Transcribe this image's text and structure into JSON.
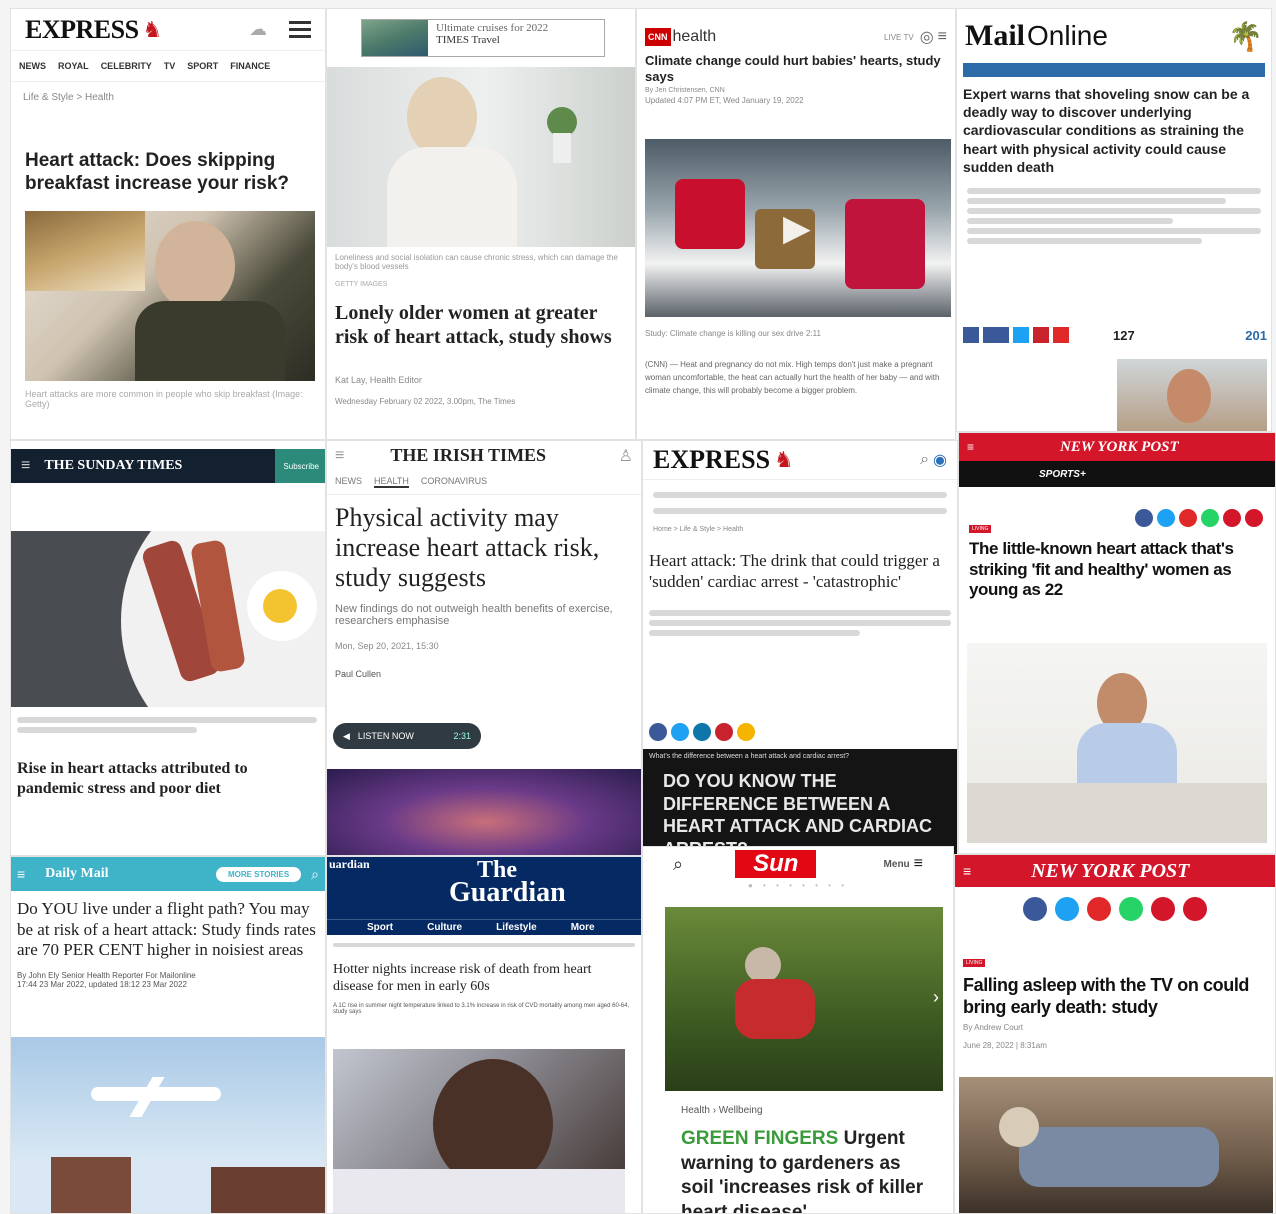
{
  "express1": {
    "logo": "EXPRESS",
    "nav": [
      "NEWS",
      "ROYAL",
      "CELEBRITY",
      "TV",
      "SPORT",
      "FINANCE"
    ],
    "breadcrumb": "Life & Style > Health",
    "headline": "Heart attack: Does skipping breakfast increase your risk?",
    "caption": "Heart attacks are more common in people who skip breakfast (Image: Getty)"
  },
  "times": {
    "ad": "Ultimate cruises for 2022",
    "ad_brand": "TIMES Travel",
    "caption": "Loneliness and social isolation can cause chronic stress, which can damage the body's blood vessels",
    "credit": "GETTY IMAGES",
    "headline": "Lonely older women at greater risk of heart attack, study shows",
    "byline": "Kat Lay, Health Editor",
    "date": "Wednesday February 02 2022, 3.00pm, The Times"
  },
  "cnn": {
    "logo": "health",
    "live": "LIVE TV",
    "headline": "Climate change could hurt babies' hearts, study says",
    "byline": "By Jen Christensen, CNN",
    "updated": "Updated 4:07 PM ET, Wed January 19, 2022",
    "video_caption": "Study: Climate change is killing our sex drive 2:11",
    "body": "(CNN) — Heat and pregnancy do not mix. High temps don't just make a pregnant woman uncomfortable, the heat can actually hurt the health of her baby — and with climate change, this will probably become a bigger problem."
  },
  "mail": {
    "logo_a": "Mail",
    "logo_b": "Online",
    "headline": "Expert warns that shoveling snow can be a deadly way to discover underlying cardiovascular conditions as straining the heart with physical activity could cause sudden death",
    "shares": "127",
    "comments": "201"
  },
  "sundaytimes": {
    "logo": "THE SUNDAY TIMES",
    "subscribe": "Subscribe",
    "headline": "Rise in heart attacks attributed to pandemic stress and poor diet"
  },
  "irish": {
    "logo": "THE IRISH TIMES",
    "nav": [
      "NEWS",
      "HEALTH",
      "CORONAVIRUS"
    ],
    "headline": "Physical activity may increase heart attack risk, study suggests",
    "standfirst": "New findings do not outweigh health benefits of exercise, researchers emphasise",
    "date": "Mon, Sep 20, 2021, 15:30",
    "byline": "Paul Cullen",
    "listen": "LISTEN NOW",
    "duration": "2:31"
  },
  "express2": {
    "logo": "EXPRESS",
    "breadcrumb": "Home > Life & Style > Health",
    "headline": "Heart attack: The drink that could trigger a 'sudden' cardiac arrest - 'catastrophic'",
    "video_title": "What's the difference between a heart attack and cardiac arrest?",
    "video_text": "DO YOU KNOW THE DIFFERENCE BETWEEN A HEART ATTACK AND CARDIAC ARREST?"
  },
  "nypost1": {
    "logo": "NEW YORK POST",
    "sports": "SPORTS+",
    "headline": "The little-known heart attack that's striking 'fit and healthy' women as young as 22",
    "tag": "LIVING"
  },
  "dailymail": {
    "logo": "Daily Mail",
    "more": "MORE STORIES",
    "headline": "Do YOU live under a flight path? You may be at risk of a heart attack: Study finds rates are 70 PER CENT higher in noisiest areas",
    "byline": "By John Ely Senior Health Reporter For Mailonline",
    "date": "17:44 23 Mar 2022, updated 18:12 23 Mar 2022"
  },
  "guardian": {
    "edge": "uardian",
    "logo_a": "The",
    "logo_b": "Guardian",
    "nav": [
      "Sport",
      "Culture",
      "Lifestyle",
      "More"
    ],
    "headline": "Hotter nights increase risk of death from heart disease for men in early 60s",
    "standfirst": "A 1C rise in summer night temperature linked to 3.1% increase in risk of CVD mortality among men aged 60-64, study says"
  },
  "sun": {
    "logo": "Sun",
    "menu": "Menu",
    "breadcrumb_a": "Health",
    "breadcrumb_b": "Wellbeing",
    "kicker": "GREEN FINGERS",
    "headline": "Urgent warning to gardeners as soil 'increases risk of killer heart disease'"
  },
  "nypost2": {
    "logo": "NEW YORK POST",
    "tag": "LIVING",
    "headline": "Falling asleep with the TV on could bring early death: study",
    "byline": "By Andrew Court",
    "date": "June 28, 2022 | 8:31am"
  }
}
